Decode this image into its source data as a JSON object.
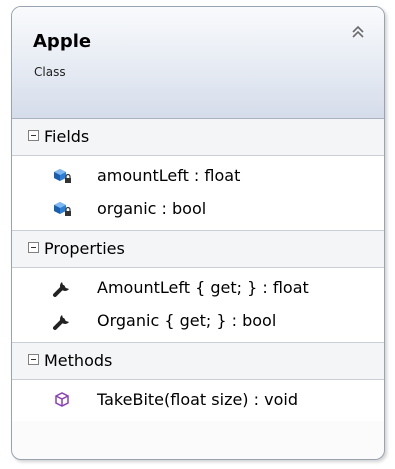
{
  "class": {
    "name": "Apple",
    "stereotype": "Class"
  },
  "sections": {
    "fields": {
      "title": "Fields",
      "items": [
        {
          "icon": "private-field-icon",
          "text": "amountLeft : float"
        },
        {
          "icon": "private-field-icon",
          "text": "organic : bool"
        }
      ]
    },
    "properties": {
      "title": "Properties",
      "items": [
        {
          "icon": "property-wrench-icon",
          "text": "AmountLeft { get; } : float"
        },
        {
          "icon": "property-wrench-icon",
          "text": "Organic { get; } : bool"
        }
      ]
    },
    "methods": {
      "title": "Methods",
      "items": [
        {
          "icon": "method-cube-icon",
          "text": "TakeBite(float size) : void"
        }
      ]
    }
  },
  "colors": {
    "field_icon": "#1e6fc8",
    "method_icon": "#8a3fb8",
    "header_gradient_bottom": "#d5dcea",
    "border": "#9aa4b0"
  }
}
